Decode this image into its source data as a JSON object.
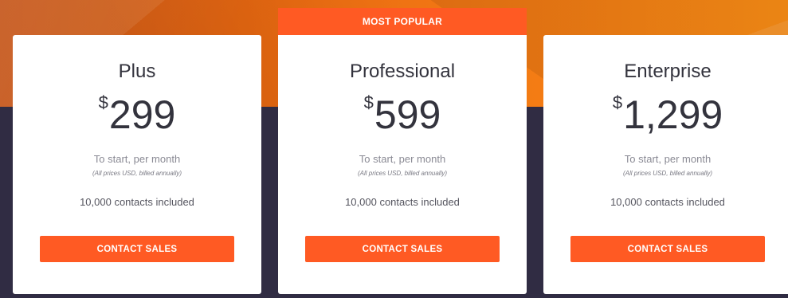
{
  "banner": {
    "label": "MOST POPULAR"
  },
  "plans": [
    {
      "name": "Plus",
      "currency": "$",
      "amount": "299",
      "period": "To start, per month",
      "billing_note": "(All prices USD, billed annually)",
      "contacts": "10,000 contacts included",
      "cta": "CONTACT SALES"
    },
    {
      "name": "Professional",
      "currency": "$",
      "amount": "599",
      "period": "To start, per month",
      "billing_note": "(All prices USD, billed annually)",
      "contacts": "10,000 contacts included",
      "cta": "CONTACT SALES"
    },
    {
      "name": "Enterprise",
      "currency": "$",
      "amount": "1,299",
      "period": "To start, per month",
      "billing_note": "(All prices USD, billed annually)",
      "contacts": "10,000 contacts included",
      "cta": "CONTACT SALES"
    }
  ],
  "colors": {
    "accent": "#ff5a23",
    "background_dark": "#302c43",
    "background_orange": "#ec6d12",
    "card": "#ffffff",
    "text_dark": "#33333d"
  }
}
